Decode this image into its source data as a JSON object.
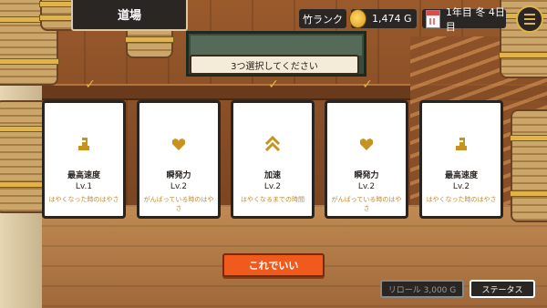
{
  "header": {
    "location": "道場",
    "rank": "竹ランク",
    "gold": "1,474 G",
    "date": "1年目 冬 4日目"
  },
  "instruction": "3つ選択してください",
  "cards": [
    {
      "icon": "boot-icon",
      "name": "最高速度",
      "level": "Lv.1",
      "description": "はやくなった時のはやさ"
    },
    {
      "icon": "heart-icon",
      "name": "瞬発力",
      "level": "Lv.2",
      "description": "がんばっている時のはやさ"
    },
    {
      "icon": "double-chevron-up-icon",
      "name": "加速",
      "level": "Lv.2",
      "description": "はやくなるまでの時間"
    },
    {
      "icon": "heart-icon",
      "name": "瞬発力",
      "level": "Lv.2",
      "description": "がんばっている時のはやさ"
    },
    {
      "icon": "boot-icon",
      "name": "最高速度",
      "level": "Lv.2",
      "description": "はやくなった時のはやさ"
    }
  ],
  "buttons": {
    "confirm": "これでいい",
    "reroll": "リロール 3,000 G",
    "status": "ステータス"
  },
  "colors": {
    "accent_gold": "#c8921e",
    "confirm_orange": "#f05a1c",
    "description_text": "#c08a30"
  }
}
